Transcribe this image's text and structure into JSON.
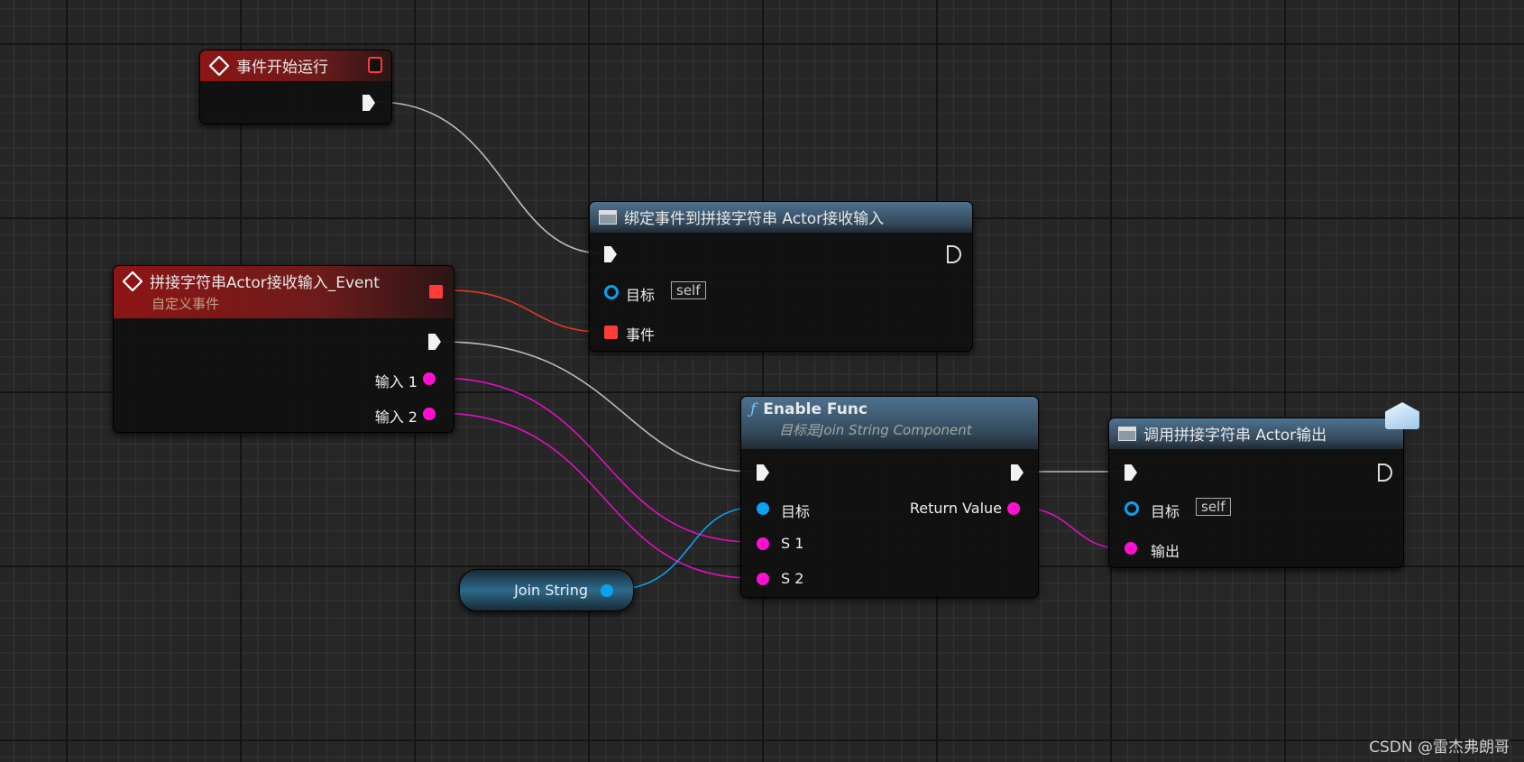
{
  "nodes": {
    "begin_play": {
      "title": "事件开始运行"
    },
    "bind": {
      "title": "绑定事件到拼接字符串 Actor接收输入",
      "target_label": "目标",
      "target_value": "self",
      "event_label": "事件"
    },
    "custom_event": {
      "title": "拼接字符串Actor接收输入_Event",
      "subtitle": "自定义事件",
      "input1": "输入 1",
      "input2": "输入 2"
    },
    "enable_func": {
      "title": "Enable Func",
      "subtitle": "目标是Join String Component",
      "target_label": "目标",
      "return_label": "Return Value",
      "s1": "S 1",
      "s2": "S 2"
    },
    "call": {
      "title": "调用拼接字符串 Actor输出",
      "target_label": "目标",
      "target_value": "self",
      "output_label": "输出"
    },
    "join_string": {
      "label": "Join String"
    }
  },
  "watermark": "CSDN @雷杰弗朗哥",
  "colors": {
    "exec": "#f2f2f2",
    "string": "#ff10d0",
    "object": "#0aa2f0",
    "delegate": "#ff3a3a",
    "event_header": "#8d1515",
    "function_header": "#4e7290"
  }
}
